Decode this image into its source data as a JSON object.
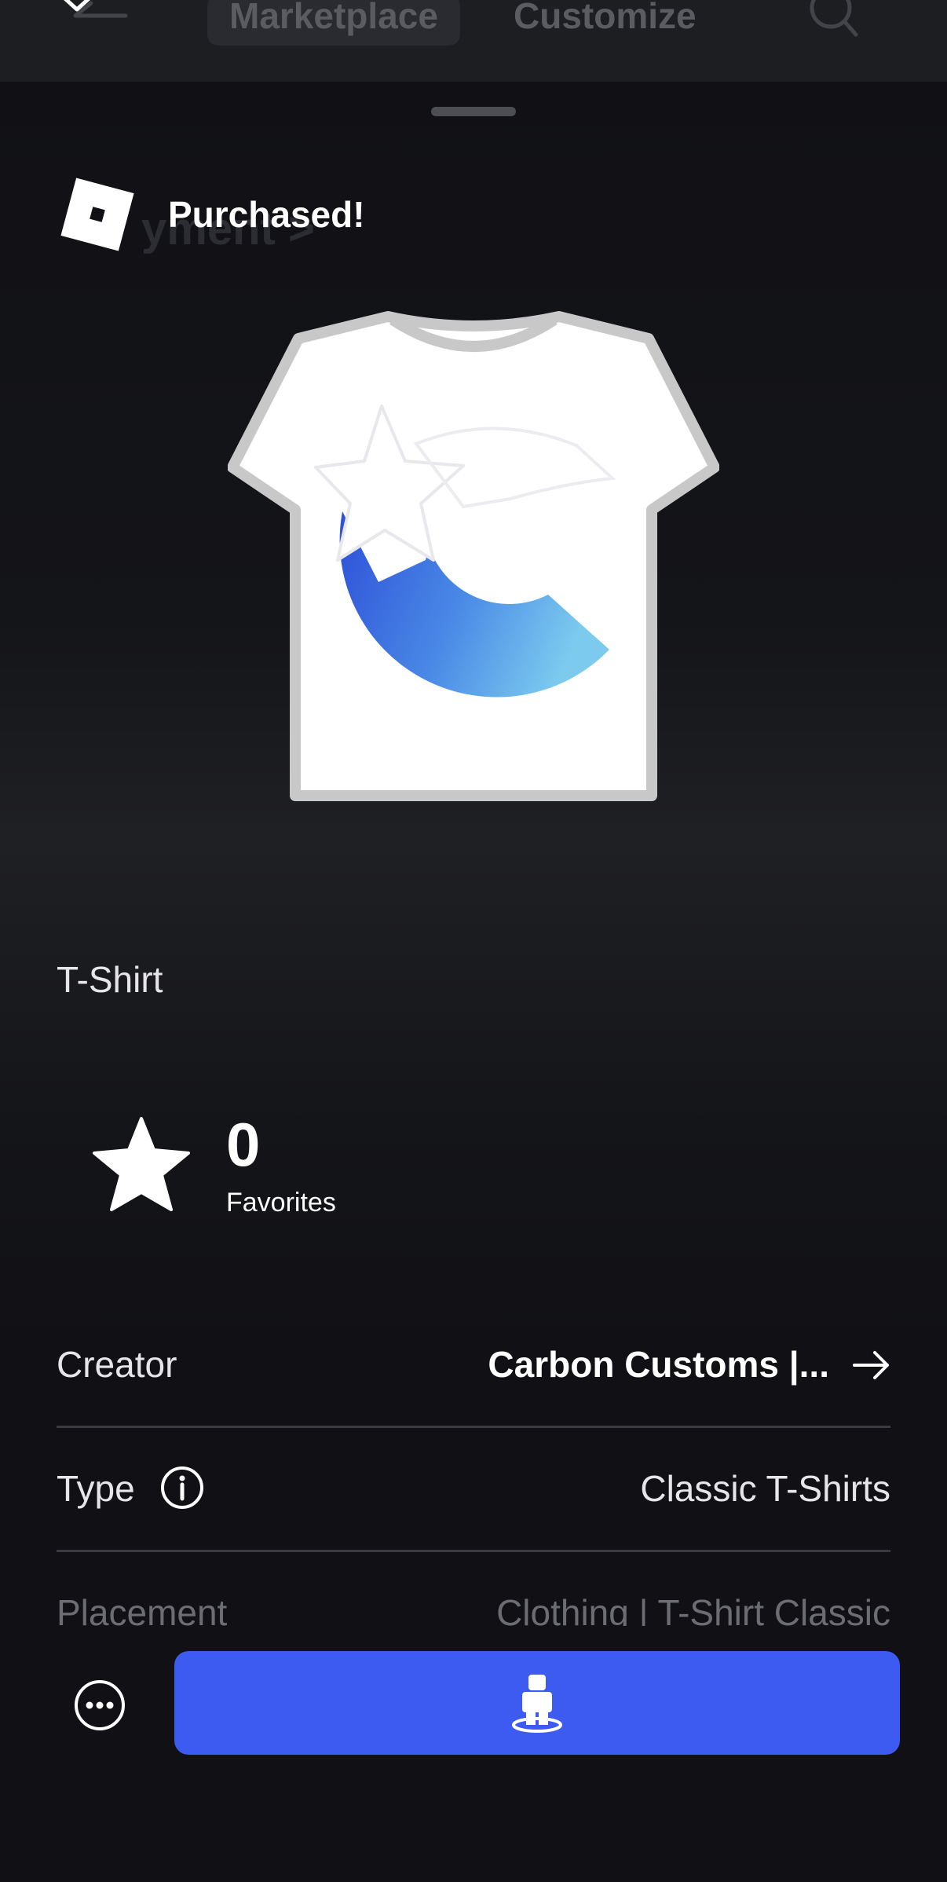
{
  "background": {
    "tabs": [
      "Marketplace",
      "Customize"
    ],
    "ghost_text": "yment >"
  },
  "toast": {
    "message": "Purchased!"
  },
  "item": {
    "type_label": "T-Shirt",
    "favorites_count": "0",
    "favorites_label": "Favorites"
  },
  "details": {
    "creator_label": "Creator",
    "creator_value": "Carbon Customs |...",
    "type_label": "Type",
    "type_value": "Classic T-Shirts",
    "placement_label": "Placement",
    "placement_value": "Clothing | T-Shirt Classic"
  },
  "colors": {
    "accent": "#3d5af1",
    "background": "#111115"
  },
  "icons": [
    "close-icon",
    "back-arrow-icon",
    "search-icon",
    "roblox-logo-icon",
    "star-icon",
    "arrow-right-icon",
    "info-icon",
    "more-icon",
    "avatar-try-on-icon"
  ]
}
